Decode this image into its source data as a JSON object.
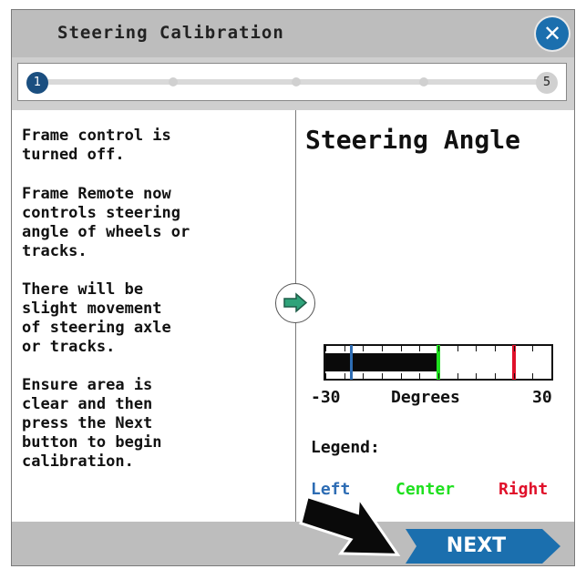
{
  "dialog": {
    "title": "Steering Calibration",
    "close_icon": "close-icon"
  },
  "progress": {
    "current_step": "1",
    "last_step": "5",
    "total_steps": 5,
    "current_index": 1
  },
  "instructions": [
    "Frame control is\nturned off.",
    "Frame Remote now\ncontrols steering\nangle of wheels or\ntracks.",
    "There will be\nslight movement\nof steering axle\nor tracks.",
    "Ensure area is\nclear and then\npress the Next\nbutton to begin\ncalibration."
  ],
  "panel": {
    "title": "Steering Angle",
    "gauge": {
      "min": -30,
      "max": 30,
      "min_label": "-30",
      "max_label": "30",
      "units_label": "Degrees",
      "left_marker": -23,
      "center_marker": 0,
      "right_marker": 20,
      "current_angle": 0
    },
    "legend_heading": "Legend:",
    "legend": [
      {
        "label": "Left",
        "color": "#2e6db4"
      },
      {
        "label": "Center",
        "color": "#1fe01f"
      },
      {
        "label": "Right",
        "color": "#e0102a"
      }
    ]
  },
  "footer": {
    "next_label": "NEXT"
  },
  "colors": {
    "accent": "#1b6fae",
    "bar_gray": "#bdbdbd"
  }
}
